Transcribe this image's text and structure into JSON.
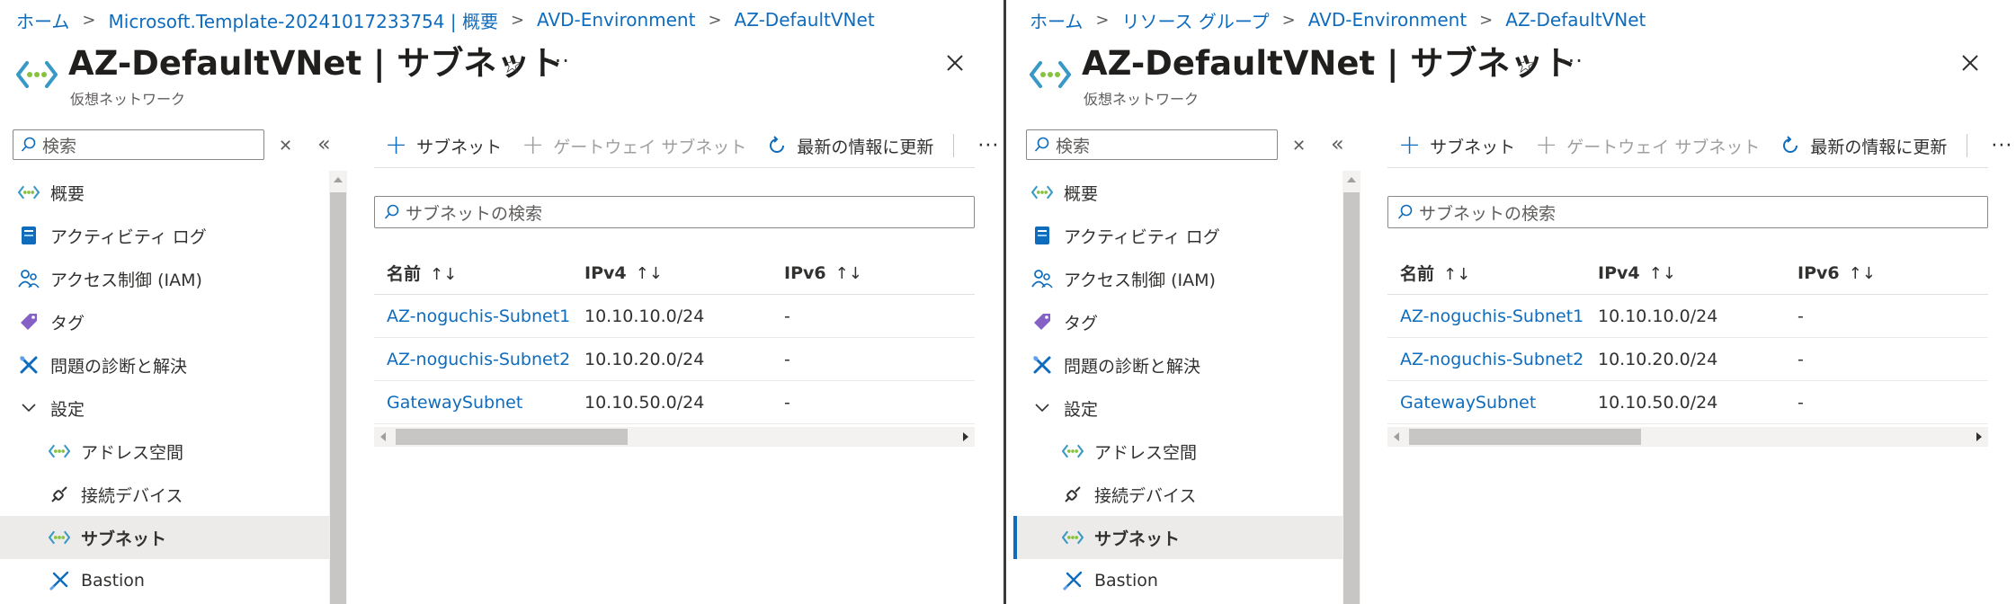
{
  "left": {
    "breadcrumb": [
      "ホーム",
      "Microsoft.Template-20241017233754 | 概要",
      "AVD-Environment",
      "AZ-DefaultVNet"
    ],
    "title": "AZ-DefaultVNet | サブネット",
    "subtitle": "仮想ネットワーク",
    "nav": {
      "search_placeholder": "検索",
      "items": [
        {
          "label": "概要",
          "icon": "vnet-icon"
        },
        {
          "label": "アクティビティ ログ",
          "icon": "activity-log-icon"
        },
        {
          "label": "アクセス制御 (IAM)",
          "icon": "iam-icon"
        },
        {
          "label": "タグ",
          "icon": "tag-icon"
        },
        {
          "label": "問題の診断と解決",
          "icon": "diagnose-icon"
        },
        {
          "label": "設定",
          "icon": "chevron-down-icon"
        },
        {
          "label": "アドレス空間",
          "icon": "address-space-icon"
        },
        {
          "label": "接続デバイス",
          "icon": "plug-icon"
        },
        {
          "label": "サブネット",
          "icon": "subnet-icon"
        },
        {
          "label": "Bastion",
          "icon": "bastion-icon"
        }
      ],
      "selected_index": 8
    },
    "toolbar": {
      "add_subnet": "サブネット",
      "gateway_subnet": "ゲートウェイ サブネット",
      "refresh": "最新の情報に更新"
    },
    "filter_placeholder": "サブネットの検索",
    "table": {
      "headers": [
        "名前",
        "IPv4",
        "IPv6"
      ],
      "rows": [
        [
          "AZ-noguchis-Subnet1",
          "10.10.10.0/24",
          "-"
        ],
        [
          "AZ-noguchis-Subnet2",
          "10.10.20.0/24",
          "-"
        ],
        [
          "GatewaySubnet",
          "10.10.50.0/24",
          "-"
        ]
      ]
    }
  },
  "right": {
    "breadcrumb": [
      "ホーム",
      "リソース グループ",
      "AVD-Environment",
      "AZ-DefaultVNet"
    ],
    "title": "AZ-DefaultVNet | サブネット",
    "subtitle": "仮想ネットワーク",
    "nav": {
      "search_placeholder": "検索",
      "items": [
        {
          "label": "概要",
          "icon": "vnet-icon"
        },
        {
          "label": "アクティビティ ログ",
          "icon": "activity-log-icon"
        },
        {
          "label": "アクセス制御 (IAM)",
          "icon": "iam-icon"
        },
        {
          "label": "タグ",
          "icon": "tag-icon"
        },
        {
          "label": "問題の診断と解決",
          "icon": "diagnose-icon"
        },
        {
          "label": "設定",
          "icon": "chevron-down-icon"
        },
        {
          "label": "アドレス空間",
          "icon": "address-space-icon"
        },
        {
          "label": "接続デバイス",
          "icon": "plug-icon"
        },
        {
          "label": "サブネット",
          "icon": "subnet-icon"
        },
        {
          "label": "Bastion",
          "icon": "bastion-icon"
        }
      ],
      "selected_index": 8
    },
    "toolbar": {
      "add_subnet": "サブネット",
      "gateway_subnet": "ゲートウェイ サブネット",
      "refresh": "最新の情報に更新"
    },
    "filter_placeholder": "サブネットの検索",
    "table": {
      "headers": [
        "名前",
        "IPv4",
        "IPv6"
      ],
      "rows": [
        [
          "AZ-noguchis-Subnet1",
          "10.10.10.0/24",
          "-"
        ],
        [
          "AZ-noguchis-Subnet2",
          "10.10.20.0/24",
          "-"
        ],
        [
          "GatewaySubnet",
          "10.10.50.0/24",
          "-"
        ]
      ]
    }
  },
  "colors": {
    "link": "#0f6cbd",
    "selected_bar": "#0f6cbd",
    "selected_bg": "#edebe9",
    "vnet_green": "#86c240",
    "vnet_blue": "#3999c6"
  }
}
